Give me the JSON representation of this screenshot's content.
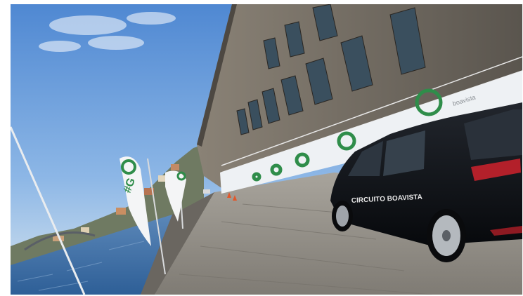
{
  "photo": {
    "car_lettering": "CIRCUITO BOAVISTA",
    "flag_lettering": "#G",
    "banner_lettering": "boavista",
    "colors": {
      "sky_top": "#5f95d8",
      "sky_bottom": "#cfe0ee",
      "river": "#3e6fa8",
      "building_stone": "#6f6a62",
      "banner_white": "#eef1f4",
      "brand_green": "#2f8d4a",
      "car_body": "#101318",
      "pavement": "#8f8c86"
    }
  }
}
